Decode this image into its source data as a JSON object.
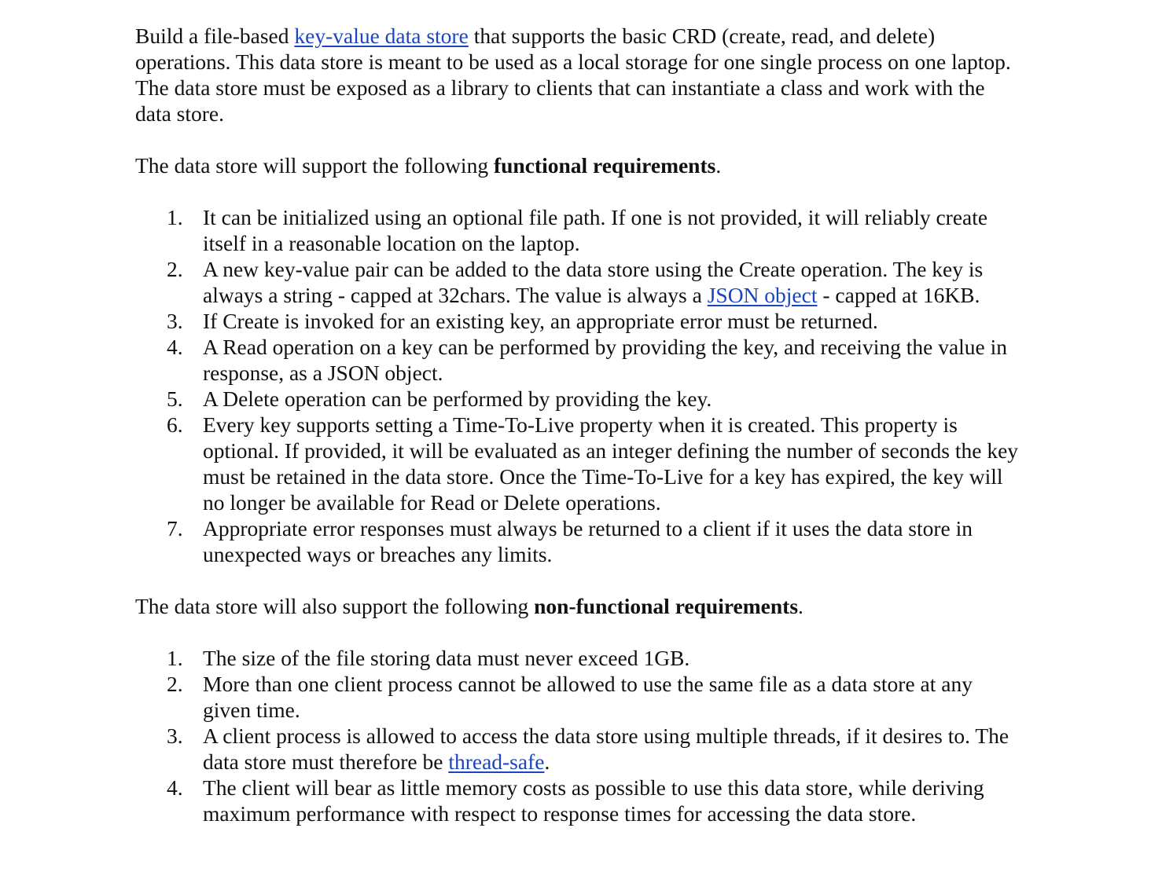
{
  "intro": {
    "before_link": "Build a file-based ",
    "link": "key-value data store",
    "after_link": " that supports the basic CRD (create, read, and delete) operations. This data store is meant to be used as a local storage for one single process on one laptop. The data store must be exposed as a library to clients that can instantiate a class and work with the data store."
  },
  "functional": {
    "lead_before": "The data store will support the following ",
    "lead_bold": "functional requirements",
    "lead_after": ".",
    "items": [
      {
        "num": "1.",
        "text": "It can be initialized using an optional file path. If one is not provided, it will reliably create itself in a reasonable location on the laptop."
      },
      {
        "num": "2.",
        "before_link": "A new key-value pair can be added to the data store using the Create operation. The key is always a string - capped at 32chars. The value is always a ",
        "link": "JSON object",
        "after_link": " - capped at 16KB."
      },
      {
        "num": "3.",
        "text": "If Create is invoked for an existing key, an appropriate error must be returned."
      },
      {
        "num": "4.",
        "text": "A Read operation on a key can be performed by providing the key, and receiving the value in response, as a JSON object."
      },
      {
        "num": "5.",
        "text": "A Delete operation can be performed by providing the key."
      },
      {
        "num": "6.",
        "text": "Every key supports setting a Time-To-Live property when it is created. This property is optional. If provided, it will be evaluated as an integer defining the number of seconds the key must be retained in the data store. Once the Time-To-Live for a key has expired, the key will no longer be available for Read or Delete operations."
      },
      {
        "num": "7.",
        "text": "Appropriate error responses must always be returned to a client if it uses the data store in unexpected ways or breaches any limits."
      }
    ]
  },
  "nonfunctional": {
    "lead_before": "The data store will also support the following ",
    "lead_bold": "non-functional requirements",
    "lead_after": ".",
    "items": [
      {
        "num": "1.",
        "text": "The size of the file storing data must never exceed 1GB."
      },
      {
        "num": "2.",
        "text": "More than one client process cannot be allowed to use the same file as a data store at any given time."
      },
      {
        "num": "3.",
        "before_link": "A client process is allowed to access the data store using multiple threads, if it desires to. The data store must therefore be ",
        "link": "thread-safe",
        "after_link": "."
      },
      {
        "num": "4.",
        "text": "The client will bear as little memory costs as possible to use this data store, while deriving maximum performance with respect to response times for accessing the data store."
      }
    ]
  },
  "colors": {
    "text": "#111111",
    "link": "#1a44c2",
    "background": "#ffffff"
  }
}
